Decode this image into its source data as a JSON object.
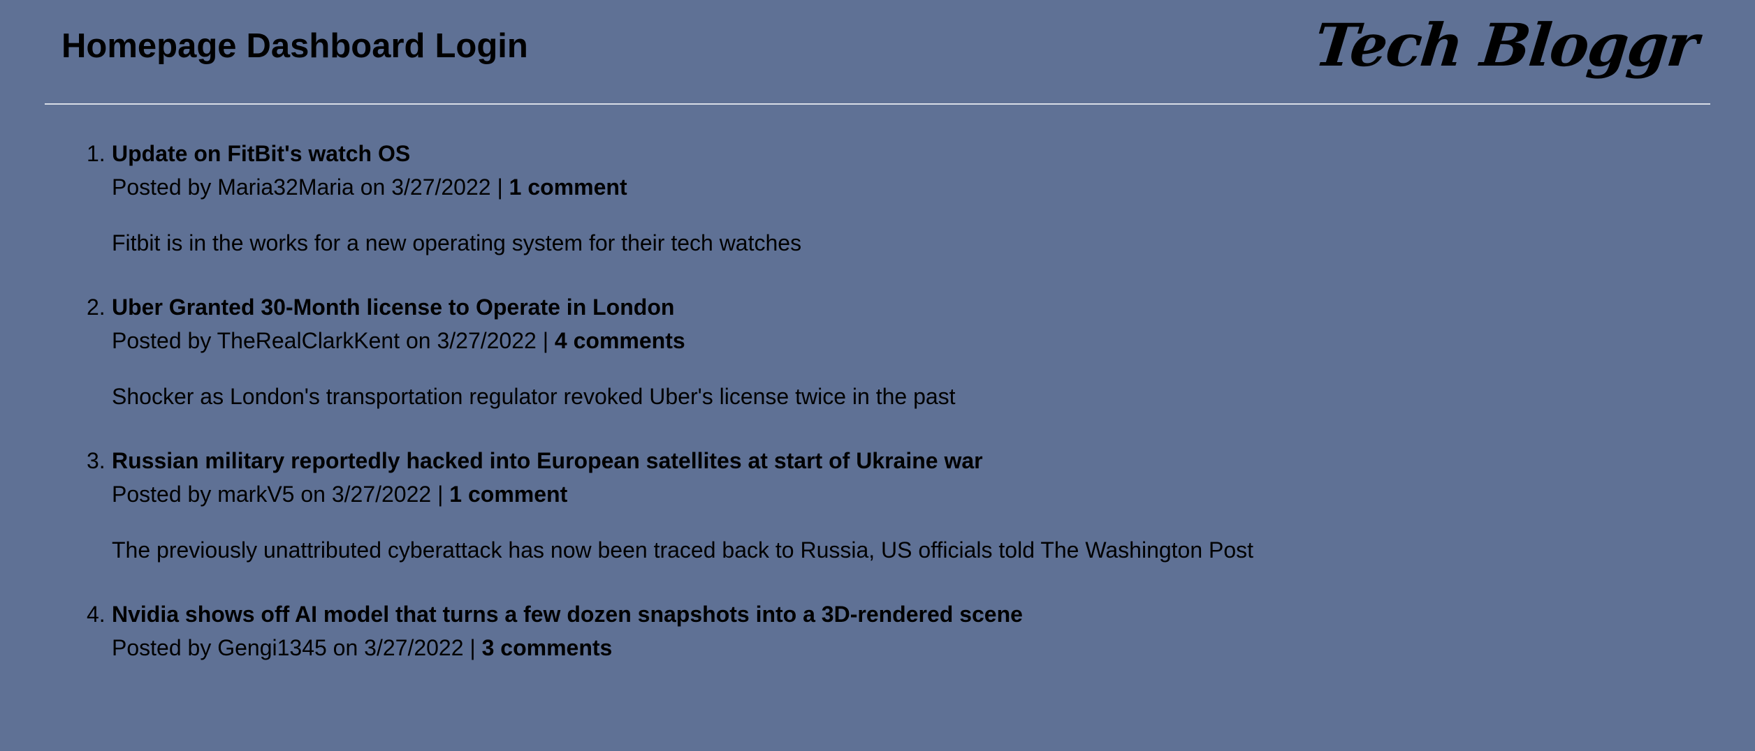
{
  "header": {
    "nav": {
      "homepage": "Homepage",
      "dashboard": "Dashboard",
      "login": "Login"
    },
    "brand": "Tech Bloggr"
  },
  "posts": [
    {
      "number": "1.",
      "title": "Update on FitBit's watch OS",
      "prefix": "Posted by",
      "author": "Maria32Maria",
      "on": "on",
      "date": "3/27/2022",
      "separator": "|",
      "comments": "1 comment",
      "description": "Fitbit is in the works for a new operating system for their tech watches"
    },
    {
      "number": "2.",
      "title": "Uber Granted 30-Month license to Operate in London",
      "prefix": "Posted by",
      "author": "TheRealClarkKent",
      "on": "on",
      "date": "3/27/2022",
      "separator": "|",
      "comments": "4 comments",
      "description": "Shocker as London's transportation regulator revoked Uber's license twice in the past"
    },
    {
      "number": "3.",
      "title": "Russian military reportedly hacked into European satellites at start of Ukraine war",
      "prefix": "Posted by",
      "author": "markV5",
      "on": "on",
      "date": "3/27/2022",
      "separator": "|",
      "comments": "1 comment",
      "description": "The previously unattributed cyberattack has now been traced back to Russia, US officials told The Washington Post"
    },
    {
      "number": "4.",
      "title": "Nvidia shows off AI model that turns a few dozen snapshots into a 3D-rendered scene",
      "prefix": "Posted by",
      "author": "Gengi1345",
      "on": "on",
      "date": "3/27/2022",
      "separator": "|",
      "comments": "3 comments",
      "description": ""
    }
  ],
  "colors": {
    "background": "#5f7195",
    "text": "#000000",
    "divider": "#d9dde6"
  }
}
